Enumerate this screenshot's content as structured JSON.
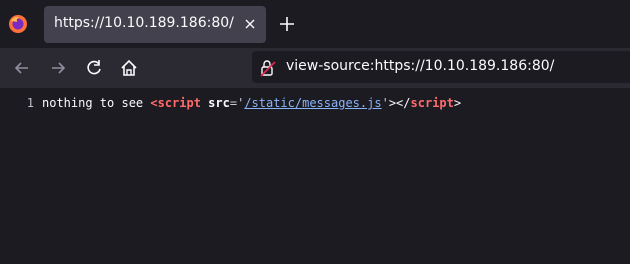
{
  "tab": {
    "title": "https://10.10.189.186:80/"
  },
  "urlbar": {
    "url": "view-source:https://10.10.189.186:80/"
  },
  "source": {
    "line_number": "1",
    "text_before": "nothing to see ",
    "tag_open": "<script",
    "attr_name": " src",
    "attr_eq_quote": "='",
    "attr_link": "/static/messages.js",
    "attr_close_quote": "'",
    "tag_gt": "></",
    "tag_close": "script",
    "final_gt": ">"
  }
}
